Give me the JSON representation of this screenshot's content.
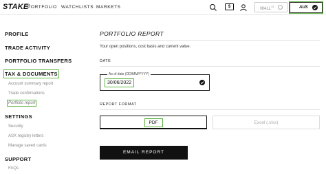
{
  "topbar": {
    "logo": "STAKE",
    "logo_mark": "+",
    "nav": [
      "PORTFOLIO",
      "WATCHLISTS",
      "MARKETS"
    ],
    "wallet_icon_text": "$",
    "wall_st_label": "WALL",
    "wall_st_sup": "ST",
    "aus_label": "AUS"
  },
  "sidebar": {
    "profile": "PROFILE",
    "trade_activity": "TRADE ACTIVITY",
    "portfolio_transfers": "PORTFOLIO TRANSFERS",
    "tax_documents": "TAX & DOCUMENTS",
    "tax_items": [
      "Account summary report",
      "Trade confirmations",
      "Portfolio report"
    ],
    "settings": "SETTINGS",
    "settings_items": [
      "Security",
      "ASX registry letters",
      "Manage saved cards"
    ],
    "support": "SUPPORT",
    "support_items": [
      "FAQs"
    ]
  },
  "main": {
    "title": "PORTFOLIO REPORT",
    "description": "Your open positions, cost basis and current value.",
    "date_label": "DATE",
    "as_of_caption": "As of date (DD/MM/YYYY)",
    "as_of_value": "30/06/2022",
    "format_label": "REPORT FORMAT",
    "format_pdf": "PDF",
    "format_xlsx": "Excel (.xlsx)",
    "email_button": "EMAIL REPORT"
  },
  "colors": {
    "highlight": "#5db33f",
    "primary": "#111111"
  }
}
